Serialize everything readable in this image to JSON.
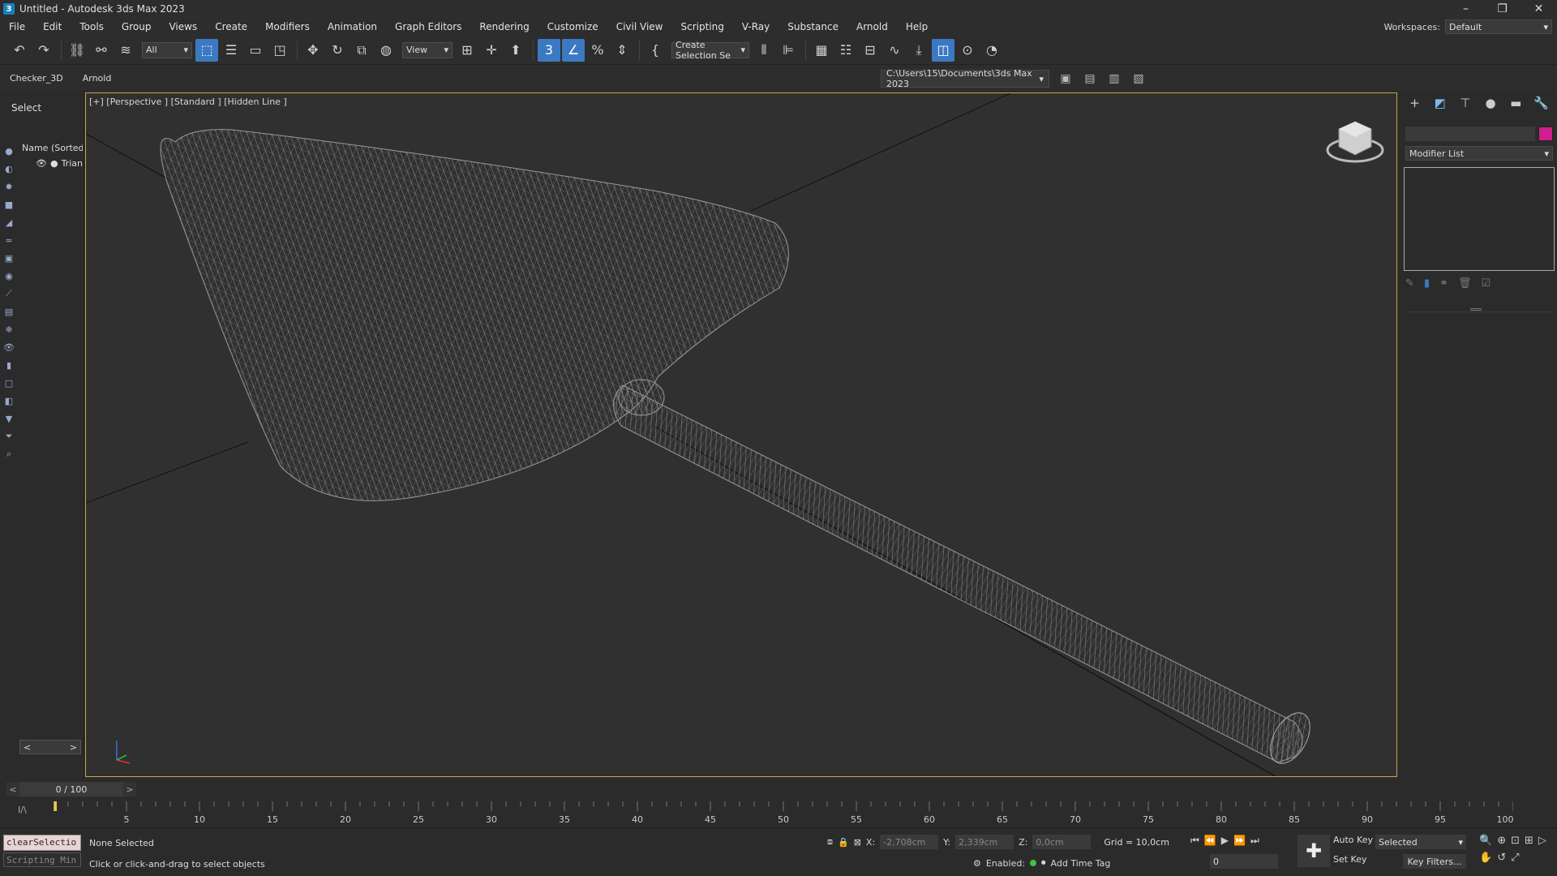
{
  "window": {
    "title": "Untitled - Autodesk 3ds Max 2023",
    "app_icon": "3",
    "controls": [
      "–",
      "❐",
      "✕"
    ]
  },
  "menu": {
    "items": [
      "File",
      "Edit",
      "Tools",
      "Group",
      "Views",
      "Create",
      "Modifiers",
      "Animation",
      "Graph Editors",
      "Rendering",
      "Customize",
      "Civil View",
      "Scripting",
      "V-Ray",
      "Substance",
      "Arnold",
      "Help"
    ],
    "workspace_label": "Workspaces:",
    "workspace_value": "Default"
  },
  "toolbar": {
    "filter_value": "All",
    "ref_coord_value": "View",
    "selection_set_value": "Create Selection Se",
    "icons": [
      "undo-icon",
      "redo-icon",
      "link-icon",
      "unlink-icon",
      "bind-space-warp-icon"
    ]
  },
  "ribbon": {
    "tabs": [
      "Checker_3D",
      "Arnold"
    ],
    "project_path": "C:\\Users\\15\\Documents\\3ds Max 2023"
  },
  "scene_explorer": {
    "select_label": "Select",
    "column_header": "Name (Sorted A",
    "rows": [
      {
        "name": "Trian"
      }
    ]
  },
  "viewport": {
    "label": "[+] [Perspective ] [Standard ] [Hidden Line ]",
    "border_color": "#c8a84a"
  },
  "command_panel": {
    "modifier_list": "Modifier List",
    "object_color": "#d01e8a"
  },
  "timeline": {
    "frame_display": "0 / 100",
    "ticks": [
      "5",
      "10",
      "15",
      "20",
      "25",
      "30",
      "35",
      "40",
      "45",
      "50",
      "55",
      "60",
      "65",
      "70",
      "75",
      "80",
      "85",
      "90",
      "95",
      "100"
    ]
  },
  "status": {
    "maxscript_line": "clearSelectio",
    "maxscript_mini": "Scripting Min",
    "selection": "None Selected",
    "prompt": "Click or click-and-drag to select objects",
    "x_label": "X:",
    "x_value": "-2,708cm",
    "y_label": "Y:",
    "y_value": "2,339cm",
    "z_label": "Z:",
    "z_value": "0,0cm",
    "grid": "Grid = 10,0cm",
    "enabled_label": "Enabled:",
    "add_time_tag": "Add Time Tag",
    "auto_key": "Auto Key",
    "set_key": "Set Key",
    "selected_dropdown": "Selected",
    "key_filters": "Key Filters...",
    "current_frame": "0"
  }
}
